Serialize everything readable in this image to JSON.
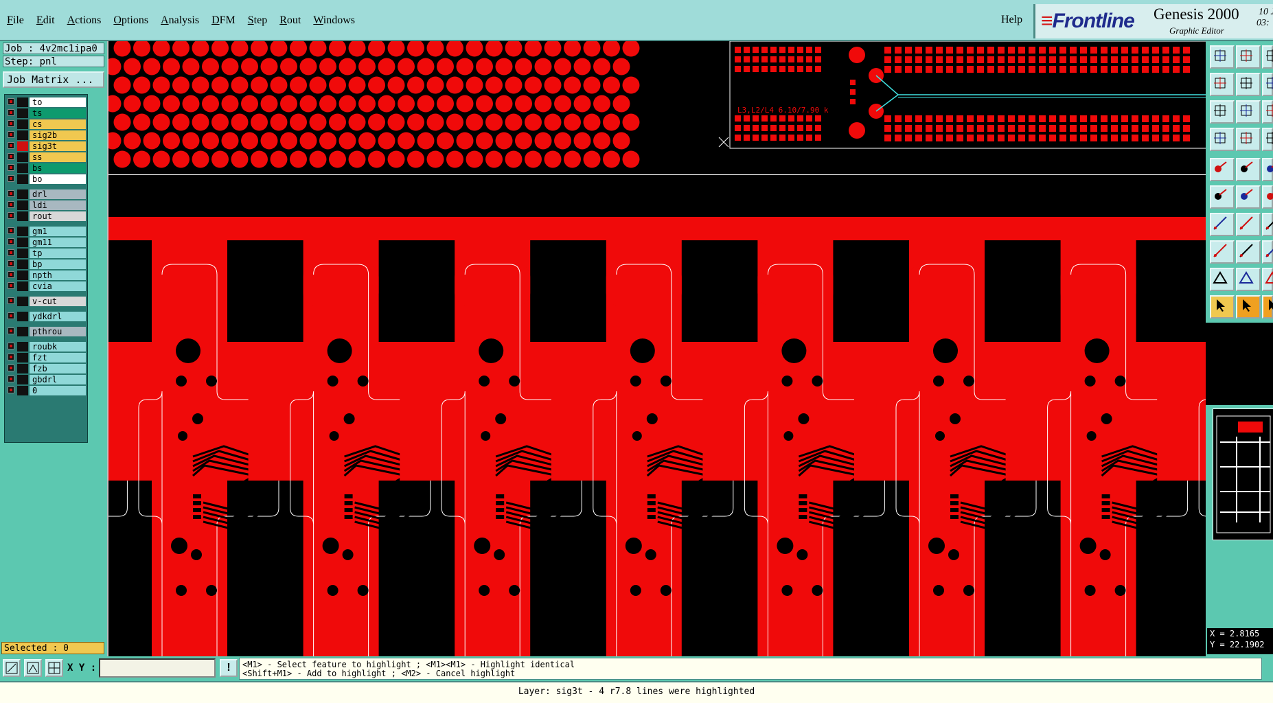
{
  "menubar": {
    "items": [
      "File",
      "Edit",
      "Actions",
      "Options",
      "Analysis",
      "DFM",
      "Step",
      "Rout",
      "Windows"
    ],
    "help": "Help"
  },
  "branding": {
    "company": "Frontline",
    "product": "Genesis 2000",
    "subtitle": "Graphic Editor",
    "date_fragment_1": "10 J",
    "date_fragment_2": "03:"
  },
  "job": {
    "job_label": "Job : 4v2mc1ipa0",
    "step_label": "Step: pnl",
    "matrix_button": "Job Matrix ..."
  },
  "layers": [
    {
      "name": "to",
      "color": "#ffffff"
    },
    {
      "name": "ts",
      "color": "#0e9a6e"
    },
    {
      "name": "cs",
      "color": "#f0c850"
    },
    {
      "name": "sig2b",
      "color": "#f0c850"
    },
    {
      "name": "sig3t",
      "color": "#f0c850"
    },
    {
      "name": "ss",
      "color": "#f0c850"
    },
    {
      "name": "bs",
      "color": "#0e9a6e"
    },
    {
      "name": "bo",
      "color": "#ffffff"
    },
    {
      "name": "drl",
      "color": "#a8b8c0"
    },
    {
      "name": "ldi",
      "color": "#a8b8c0"
    },
    {
      "name": "rout",
      "color": "#d8d8d8"
    },
    {
      "name": "gm1",
      "color": "#8fd8d8"
    },
    {
      "name": "gm11",
      "color": "#8fd8d8"
    },
    {
      "name": "tp",
      "color": "#8fd8d8"
    },
    {
      "name": "bp",
      "color": "#8fd8d8"
    },
    {
      "name": "npth",
      "color": "#8fd8d8"
    },
    {
      "name": "cvia",
      "color": "#8fd8d8"
    },
    {
      "name": "v-cut",
      "color": "#d8d8d8"
    },
    {
      "name": "ydkdrl",
      "color": "#8fd8d8"
    },
    {
      "name": "pthrou",
      "color": "#a8b8c0"
    },
    {
      "name": "roubk",
      "color": "#8fd8d8"
    },
    {
      "name": "fzt",
      "color": "#8fd8d8"
    },
    {
      "name": "fzb",
      "color": "#8fd8d8"
    },
    {
      "name": "gbdrl",
      "color": "#8fd8d8"
    },
    {
      "name": "0",
      "color": "#8fd8d8"
    }
  ],
  "selected_label": "Selected : 0",
  "canvas": {
    "annotation": "L3,L2/L4 6.10/7.90 k",
    "pcb_color": "#f00a0a",
    "outline_color": "#ffffff"
  },
  "coordinates": {
    "x": "X = 2.8165",
    "y": "Y = 22.1902"
  },
  "bottom": {
    "xy_label": "X Y :",
    "xy_value": "",
    "hint_line1": "<M1> - Select feature to highlight ; <M1><M1> - Highlight identical",
    "hint_line2": "<Shift+M1> - Add to highlight ; <M2> - Cancel highlight",
    "status": "Layer: sig3t - 4 r7.8 lines were highlighted"
  },
  "icons": [
    "zoom-area-icon",
    "measure-icon",
    "grid-icon",
    "info-icon"
  ]
}
